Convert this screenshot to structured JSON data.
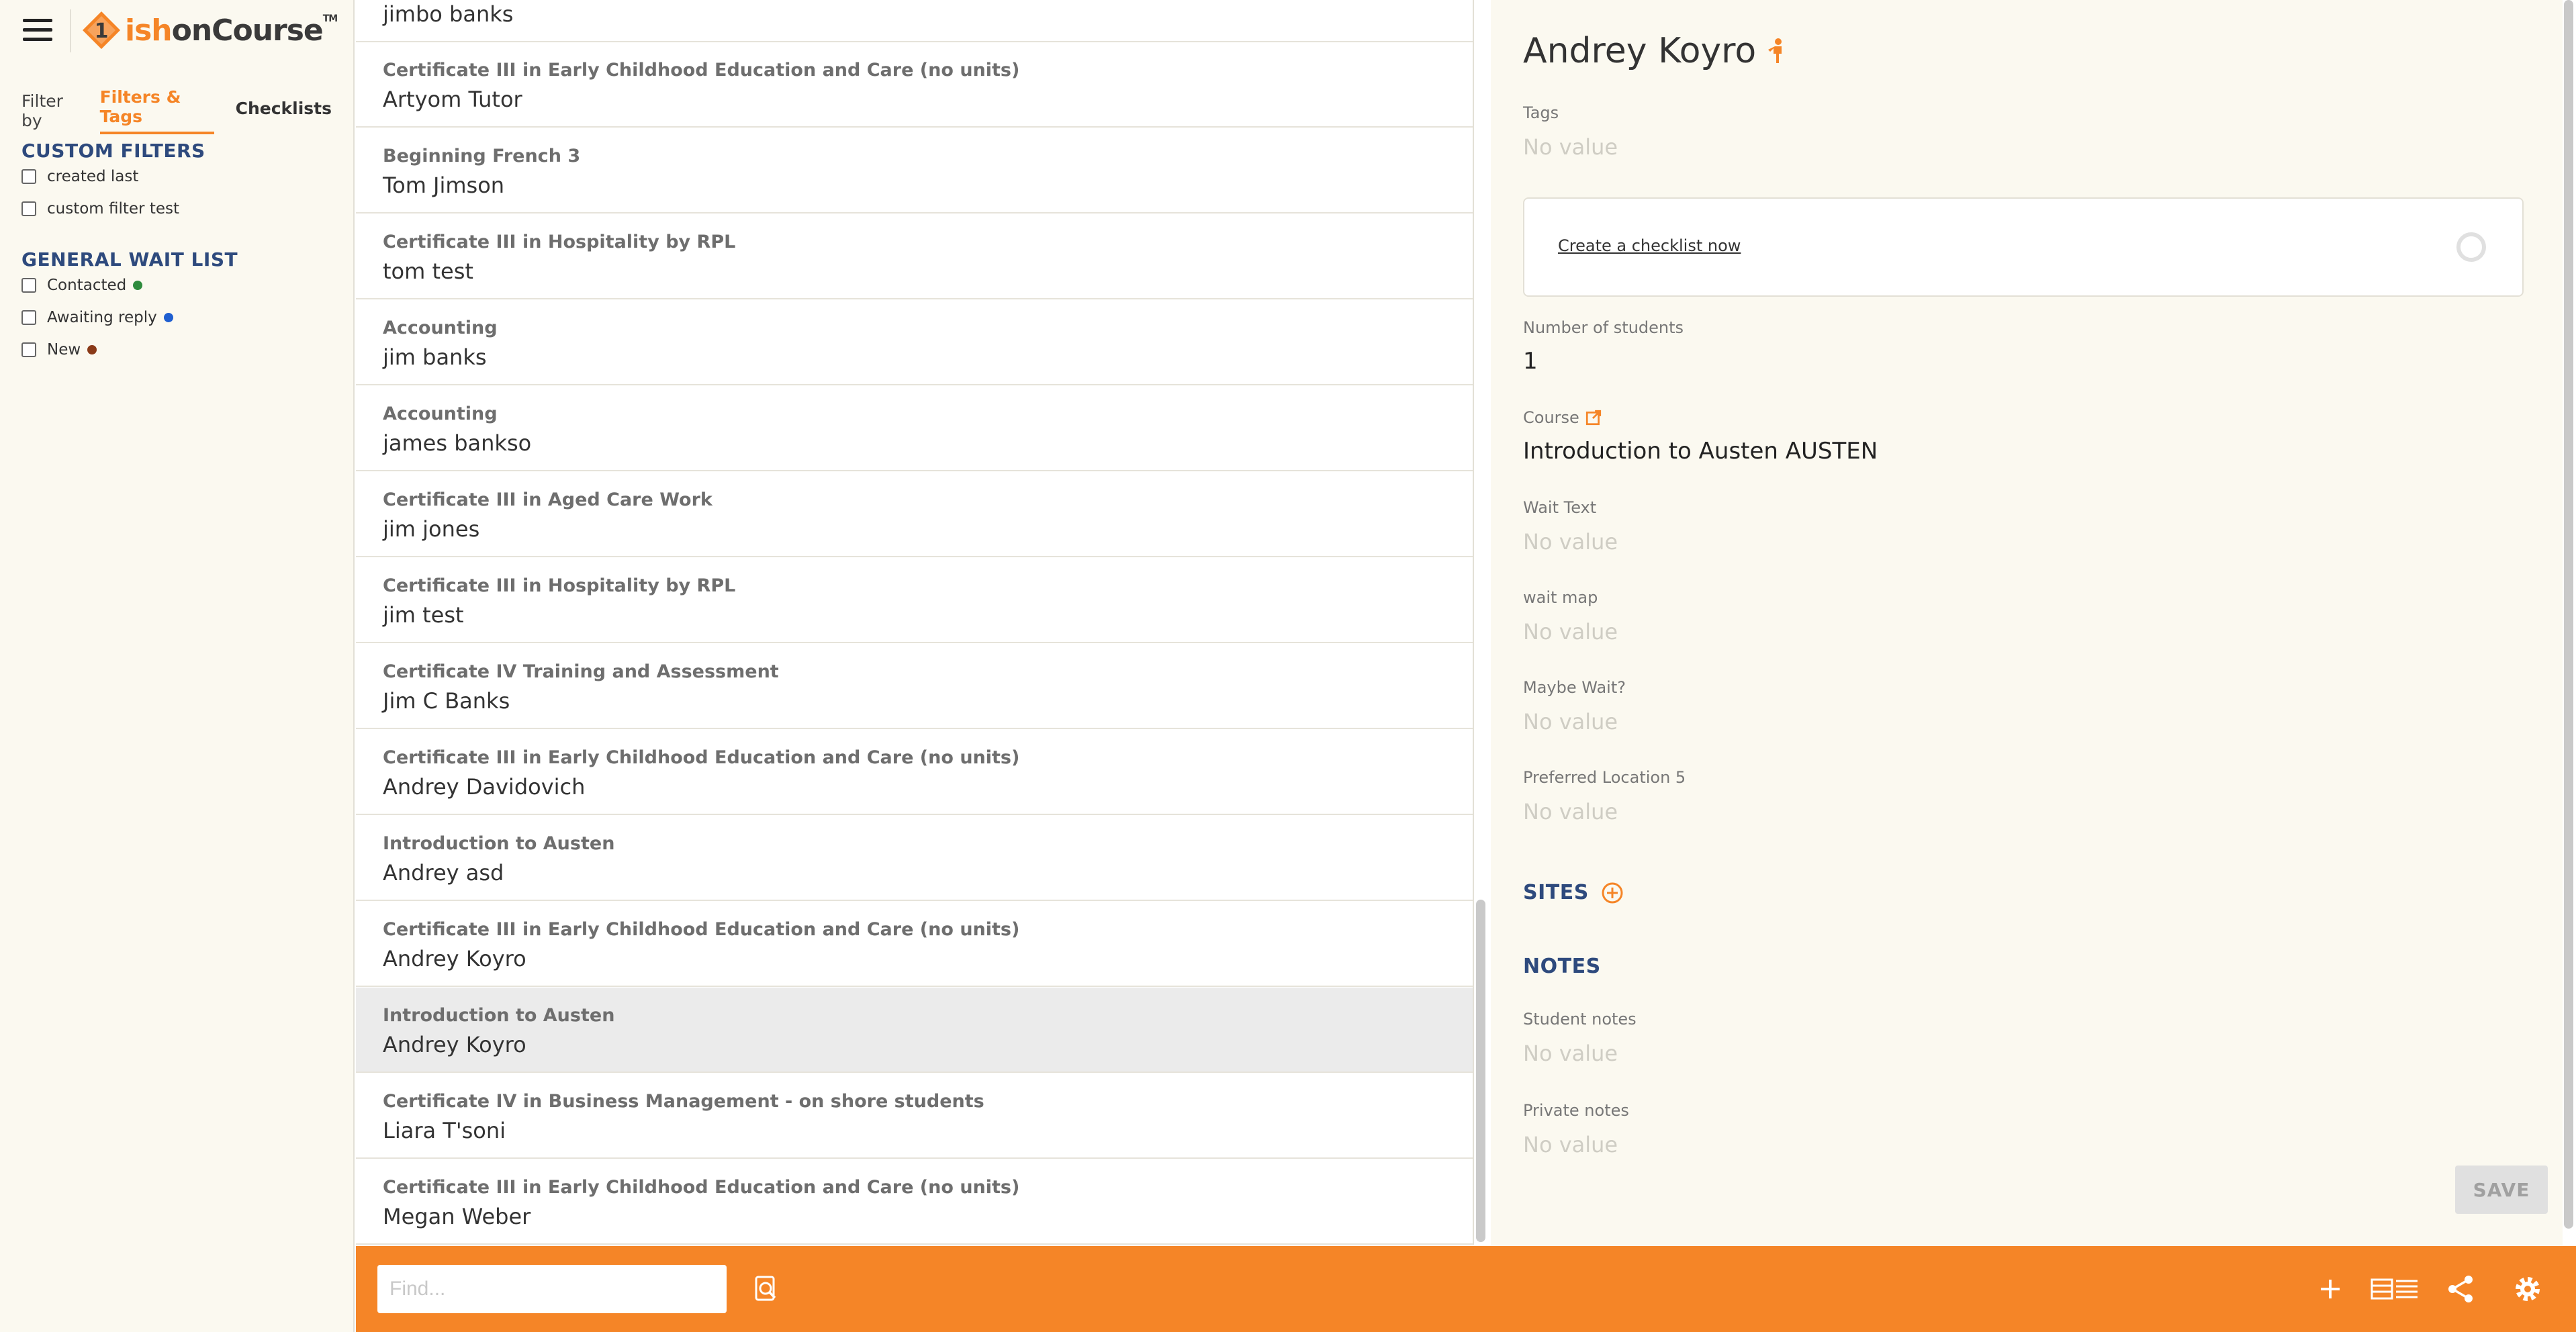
{
  "app": {
    "logo_text_ish": "ish",
    "logo_text_oncourse": "onCourse",
    "logo_tm": "TM"
  },
  "sidebar": {
    "filter_by_label": "Filter by",
    "tabs": [
      {
        "label": "Filters & Tags",
        "active": true
      },
      {
        "label": "Checklists",
        "active": false
      }
    ],
    "custom_filters": {
      "title": "CUSTOM FILTERS",
      "items": [
        {
          "label": "created last",
          "checked": false
        },
        {
          "label": "custom filter test",
          "checked": false
        }
      ]
    },
    "general_wait_list": {
      "title": "GENERAL WAIT LIST",
      "items": [
        {
          "label": "Contacted",
          "checked": false,
          "color": "#2e8b3d"
        },
        {
          "label": "Awaiting reply",
          "checked": false,
          "color": "#1f5fd0"
        },
        {
          "label": "New",
          "checked": false,
          "color": "#8a3a18"
        }
      ]
    }
  },
  "list": {
    "top_partial_name": "jimbo banks",
    "items": [
      {
        "course": "Certificate III in Early Childhood Education and Care (no units)",
        "name": "Artyom Tutor"
      },
      {
        "course": "Beginning French 3",
        "name": "Tom Jimson"
      },
      {
        "course": "Certificate III in Hospitality by RPL",
        "name": "tom test"
      },
      {
        "course": "Accounting",
        "name": "jim banks"
      },
      {
        "course": "Accounting",
        "name": "james bankso"
      },
      {
        "course": "Certificate III in Aged Care Work",
        "name": "jim jones"
      },
      {
        "course": "Certificate III in Hospitality by RPL",
        "name": "jim test"
      },
      {
        "course": "Certificate IV Training and Assessment",
        "name": "Jim C Banks"
      },
      {
        "course": "Certificate III in Early Childhood Education and Care (no units)",
        "name": "Andrey Davidovich"
      },
      {
        "course": "Introduction to Austen",
        "name": "Andrey asd"
      },
      {
        "course": "Certificate III in Early Childhood Education and Care (no units)",
        "name": "Andrey Koyro"
      },
      {
        "course": "Introduction to Austen",
        "name": "Andrey Koyro",
        "selected": true
      },
      {
        "course": "Certificate IV in Business Management - on shore students",
        "name": "Liara T'soni"
      },
      {
        "course": "Certificate III in Early Childhood Education and Care (no units)",
        "name": "Megan Weber"
      }
    ]
  },
  "bottom_bar": {
    "find_placeholder": "Find...",
    "icons": [
      "search-advanced-icon",
      "plus-icon",
      "view-toggle-icon",
      "share-icon",
      "gear-icon"
    ]
  },
  "detail": {
    "title": "Andrey Koyro",
    "tags_label": "Tags",
    "tags_value": "No value",
    "checklist_link": "Create a checklist now",
    "students_label": "Number of students",
    "students_value": "1",
    "course_label": "Course",
    "course_value": "Introduction to Austen AUSTEN",
    "wait_text_label": "Wait Text",
    "wait_text_value": "No value",
    "wait_map_label": "wait map",
    "wait_map_value": "No value",
    "maybe_wait_label": "Maybe Wait?",
    "maybe_wait_value": "No value",
    "preferred_location_label": "Preferred Location 5",
    "preferred_location_value": "No value",
    "sites_title": "SITES",
    "notes_title": "NOTES",
    "student_notes_label": "Student notes",
    "student_notes_value": "No value",
    "private_notes_label": "Private notes",
    "private_notes_value": "No value",
    "save_label": "SAVE"
  },
  "colors": {
    "accent": "#f58527",
    "heading_blue": "#2e4a7d",
    "sidebar_bg": "#fbf9f0"
  }
}
